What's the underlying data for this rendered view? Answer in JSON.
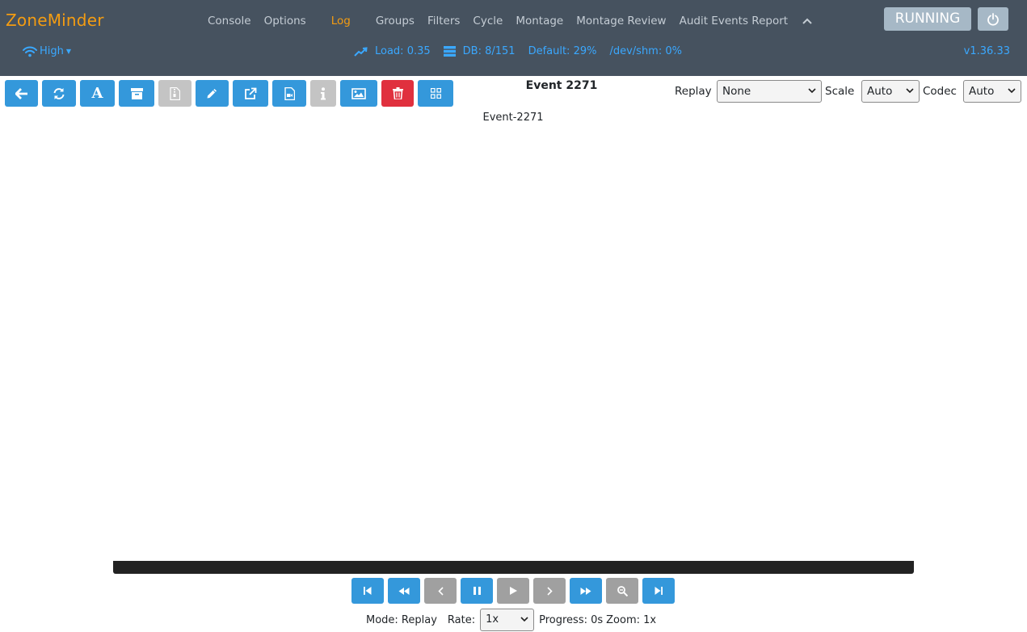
{
  "brand": "ZoneMinder",
  "nav": {
    "items": [
      {
        "id": "console",
        "label": "Console"
      },
      {
        "id": "options",
        "label": "Options"
      },
      {
        "id": "log",
        "label": "Log",
        "active": true
      },
      {
        "id": "groups",
        "label": "Groups"
      },
      {
        "id": "filters",
        "label": "Filters"
      },
      {
        "id": "cycle",
        "label": "Cycle"
      },
      {
        "id": "montage",
        "label": "Montage"
      },
      {
        "id": "montage-review",
        "label": "Montage Review"
      },
      {
        "id": "audit-events-report",
        "label": "Audit Events Report"
      }
    ],
    "collapse_icon": "chevron-up-icon"
  },
  "status": {
    "running_label": "RUNNING",
    "power_icon": "power-icon",
    "bandwidth_label": "High",
    "load": "Load: 0.35",
    "db": "DB: 8/151",
    "default_storage": "Default: 29%",
    "shm": "/dev/shm: 0%",
    "version": "v1.36.33"
  },
  "toolbar": {
    "buttons": [
      {
        "id": "back",
        "icon": "arrow-left-icon",
        "state": "enabled"
      },
      {
        "id": "refresh",
        "icon": "refresh-icon",
        "state": "enabled"
      },
      {
        "id": "rename",
        "icon": "font-icon",
        "state": "enabled"
      },
      {
        "id": "archive",
        "icon": "archive-icon",
        "state": "enabled"
      },
      {
        "id": "unarchive",
        "icon": "file-archive-icon",
        "state": "disabled"
      },
      {
        "id": "edit",
        "icon": "pencil-icon",
        "state": "enabled"
      },
      {
        "id": "export",
        "icon": "external-link-icon",
        "state": "enabled"
      },
      {
        "id": "download-video",
        "icon": "file-video-icon",
        "state": "enabled"
      },
      {
        "id": "info",
        "icon": "info-icon",
        "state": "disabled"
      },
      {
        "id": "frames",
        "icon": "image-icon",
        "state": "enabled"
      },
      {
        "id": "delete",
        "icon": "trash-icon",
        "state": "danger"
      },
      {
        "id": "stats",
        "icon": "grid-icon",
        "state": "enabled"
      }
    ]
  },
  "event": {
    "title": "Event 2271",
    "name": "Event-2271"
  },
  "controls": {
    "replay_label": "Replay",
    "replay_value": "None",
    "scale_label": "Scale",
    "scale_value": "Auto",
    "codec_label": "Codec",
    "codec_value": "Auto"
  },
  "playback": {
    "progress_fraction": 0,
    "buttons": [
      {
        "id": "prev-event",
        "icon": "step-backward-icon",
        "state": "enabled"
      },
      {
        "id": "fast-rev",
        "icon": "fast-rewind-icon",
        "state": "enabled"
      },
      {
        "id": "step-rev",
        "icon": "chevron-left-icon",
        "state": "disabled"
      },
      {
        "id": "pause",
        "icon": "pause-icon",
        "state": "enabled"
      },
      {
        "id": "play",
        "icon": "play-icon",
        "state": "disabled"
      },
      {
        "id": "step-fwd",
        "icon": "chevron-right-icon",
        "state": "disabled"
      },
      {
        "id": "fast-fwd",
        "icon": "fast-forward-icon",
        "state": "enabled"
      },
      {
        "id": "zoom-out",
        "icon": "zoom-out-icon",
        "state": "disabled"
      },
      {
        "id": "next-event",
        "icon": "step-forward-icon",
        "state": "enabled"
      }
    ],
    "mode_text": "Mode: Replay",
    "rate_label": "Rate:",
    "rate_value": "1x",
    "progress_text": "Progress: 0s",
    "zoom_text": "Zoom: 1x"
  },
  "colors": {
    "navbar_bg": "#46525f",
    "brand": "#f39c12",
    "primary_button": "#3498db",
    "danger_button": "#e0303e",
    "disabled_button": "#c4c4c4",
    "status_link": "#3aa8ff"
  }
}
